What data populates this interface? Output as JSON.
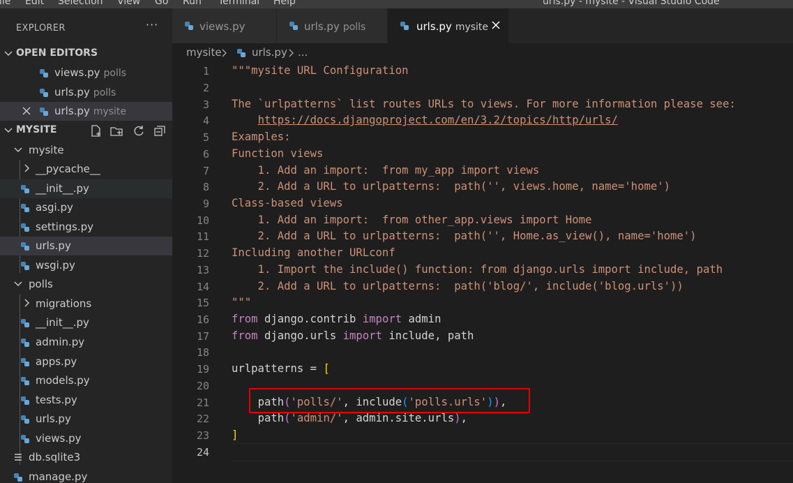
{
  "menu": [
    "ile",
    "Edit",
    "Selection",
    "View",
    "Go",
    "Run",
    "Terminal",
    "Help"
  ],
  "window_title": "urls.py - mysite - Visual Studio Code",
  "explorer": {
    "title": "EXPLORER",
    "more_icon": "ellipsis-icon",
    "open_editors": {
      "label": "OPEN EDITORS",
      "items": [
        {
          "name": "views.py",
          "folder": "polls"
        },
        {
          "name": "urls.py",
          "folder": "polls"
        },
        {
          "name": "urls.py",
          "folder": "mysite"
        }
      ]
    },
    "project": {
      "label": "MYSITE",
      "actions": [
        "new-file-icon",
        "new-folder-icon",
        "refresh-icon",
        "collapse-all-icon"
      ]
    },
    "tree": [
      {
        "label": "mysite"
      },
      {
        "label": "__pycache__"
      },
      {
        "label": "__init__.py"
      },
      {
        "label": "asgi.py"
      },
      {
        "label": "settings.py"
      },
      {
        "label": "urls.py"
      },
      {
        "label": "wsgi.py"
      },
      {
        "label": "polls"
      },
      {
        "label": "migrations"
      },
      {
        "label": "__init__.py"
      },
      {
        "label": "admin.py"
      },
      {
        "label": "apps.py"
      },
      {
        "label": "models.py"
      },
      {
        "label": "tests.py"
      },
      {
        "label": "urls.py"
      },
      {
        "label": "views.py"
      },
      {
        "label": "db.sqlite3"
      },
      {
        "label": "manage.py"
      }
    ]
  },
  "tabs": [
    {
      "name": "views.py",
      "folder": ""
    },
    {
      "name": "urls.py",
      "folder": "polls"
    },
    {
      "name": "urls.py",
      "folder": "mysite"
    }
  ],
  "breadcrumb": {
    "folder": "mysite",
    "file": "urls.py",
    "more": "..."
  },
  "editor": {
    "line_numbers": [
      "1",
      "2",
      "3",
      "4",
      "5",
      "6",
      "7",
      "8",
      "9",
      "10",
      "11",
      "12",
      "13",
      "14",
      "15",
      "16",
      "17",
      "18",
      "19",
      "20",
      "21",
      "22",
      "23",
      "24"
    ],
    "doc": {
      "l1": "\"\"\"mysite URL Configuration",
      "l3": "The `urlpatterns` list routes URLs to views. For more information please see:",
      "l4_indent": "    ",
      "l4_link": "https://docs.djangoproject.com/en/3.2/topics/http/urls/",
      "l5": "Examples:",
      "l6": "Function views",
      "l7": "    1. Add an import:  from my_app import views",
      "l8": "    2. Add a URL to urlpatterns:  path('', views.home, name='home')",
      "l9": "Class-based views",
      "l10": "    1. Add an import:  from other_app.views import Home",
      "l11": "    2. Add a URL to urlpatterns:  path('', Home.as_view(), name='home')",
      "l12": "Including another URLconf",
      "l13": "    1. Import the include() function: from django.urls import include, path",
      "l14": "    2. Add a URL to urlpatterns:  path('blog/', include('blog.urls'))",
      "l15": "\"\"\""
    },
    "tok": {
      "from": "from",
      "import": "import",
      "l16_mod": " django.contrib ",
      "l16_name": " admin",
      "l17_mod": " django.urls ",
      "l17_names": " include, path",
      "l19_var": "urlpatterns = ",
      "open_bracket": "[",
      "close_bracket": "]",
      "indent": "    ",
      "path": "path",
      "lparen": "(",
      "rparen": ")",
      "comma_sp": ", ",
      "comma": ",",
      "include": "include",
      "l21_arg1": "'polls/'",
      "l21_arg2": "'polls.urls'",
      "l22_arg1": "'admin/'",
      "l22_rest": "admin.site.urls"
    }
  }
}
